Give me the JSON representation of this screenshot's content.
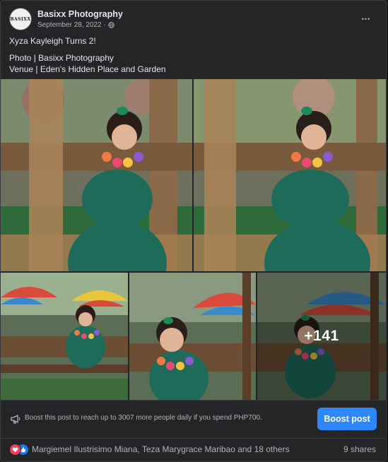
{
  "post": {
    "avatar_logo": "BASIXX",
    "page_name": "Basixx Photography",
    "date": "September 28, 2022",
    "dot": "·",
    "more_label": "•••",
    "title_line": "Xyza Kayleigh Turns 2!",
    "line_photo": "Photo | Basixx Photography",
    "line_venue": "Venue | Eden's Hidden Place and Garden"
  },
  "gallery": {
    "more_count": "+141",
    "photos": [
      {
        "name": "photo-1",
        "colors": [
          "#8a6a48",
          "#3f5a3a",
          "#1e6b5a"
        ]
      },
      {
        "name": "photo-2",
        "colors": [
          "#9a7a56",
          "#4a6a40",
          "#1e6b5a"
        ]
      },
      {
        "name": "photo-3",
        "colors": [
          "#c74a3a",
          "#3d8c4b",
          "#2a6a58"
        ]
      },
      {
        "name": "photo-4",
        "colors": [
          "#6e5a44",
          "#2f6a3a",
          "#1f5e52"
        ]
      },
      {
        "name": "photo-5",
        "colors": [
          "#7a6a50",
          "#3a6e3f",
          "#1f5e52"
        ]
      }
    ]
  },
  "boost": {
    "message": "Boost this post to reach up to 3007 more people daily if you spend PHP700.",
    "button_label": "Boost post",
    "button_color": "#2d88ff"
  },
  "reactions": {
    "names": "Margiemel Ilustrisimo Miana, Teza Marygrace Maribao and 18 others",
    "shares": "9 shares",
    "icons": [
      "love-icon",
      "like-icon"
    ]
  }
}
